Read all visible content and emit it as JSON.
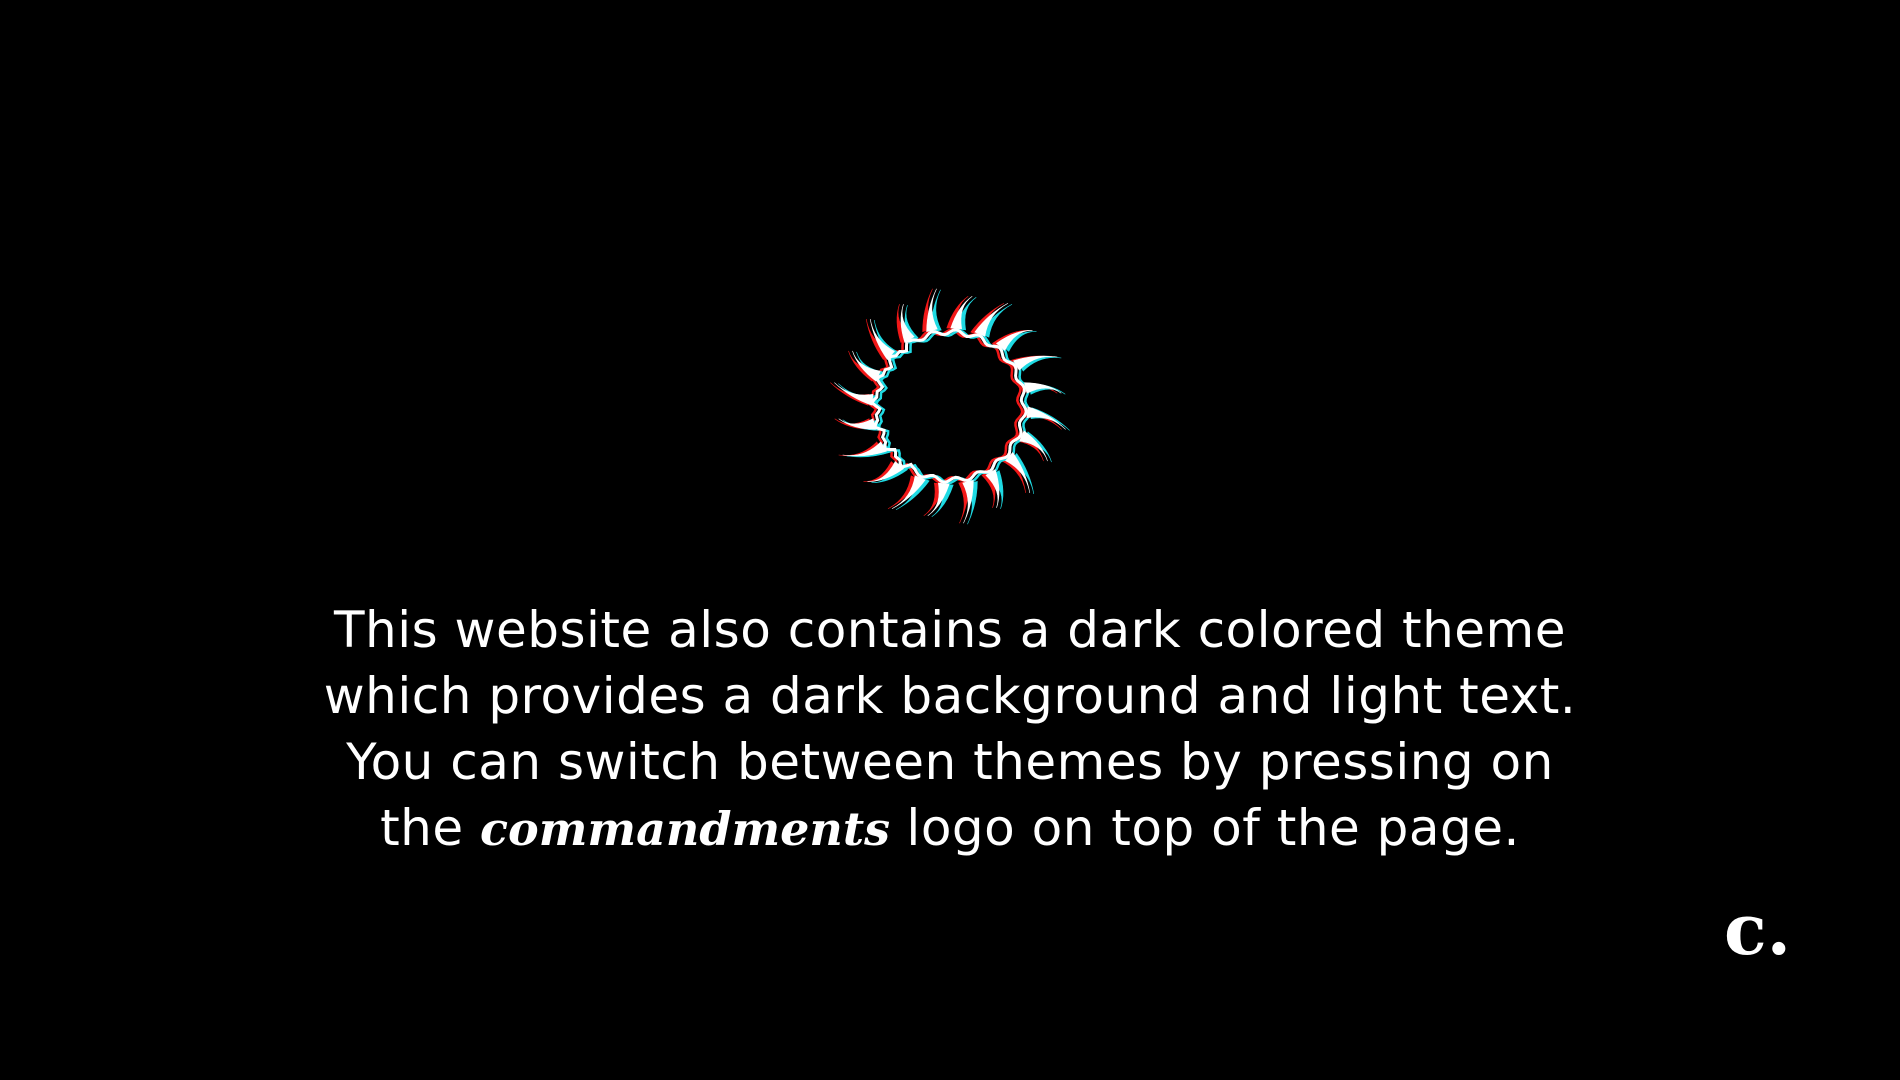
{
  "screen": {
    "background": "#000000",
    "text_color": "#ffffff",
    "glitch_colors": [
      "#ff1a1a",
      "#21e6f0"
    ]
  },
  "emblem": {
    "icon": "sun-burst-icon"
  },
  "message": {
    "line1": "This website also contains a dark colored theme",
    "line2": "which provides a dark background and light text.",
    "line3": "You can switch between themes by pressing on",
    "line4_before": "the",
    "line4_brand": "commandments",
    "line4_after": "logo on top of the page."
  },
  "corner_logo": {
    "text": "c."
  }
}
